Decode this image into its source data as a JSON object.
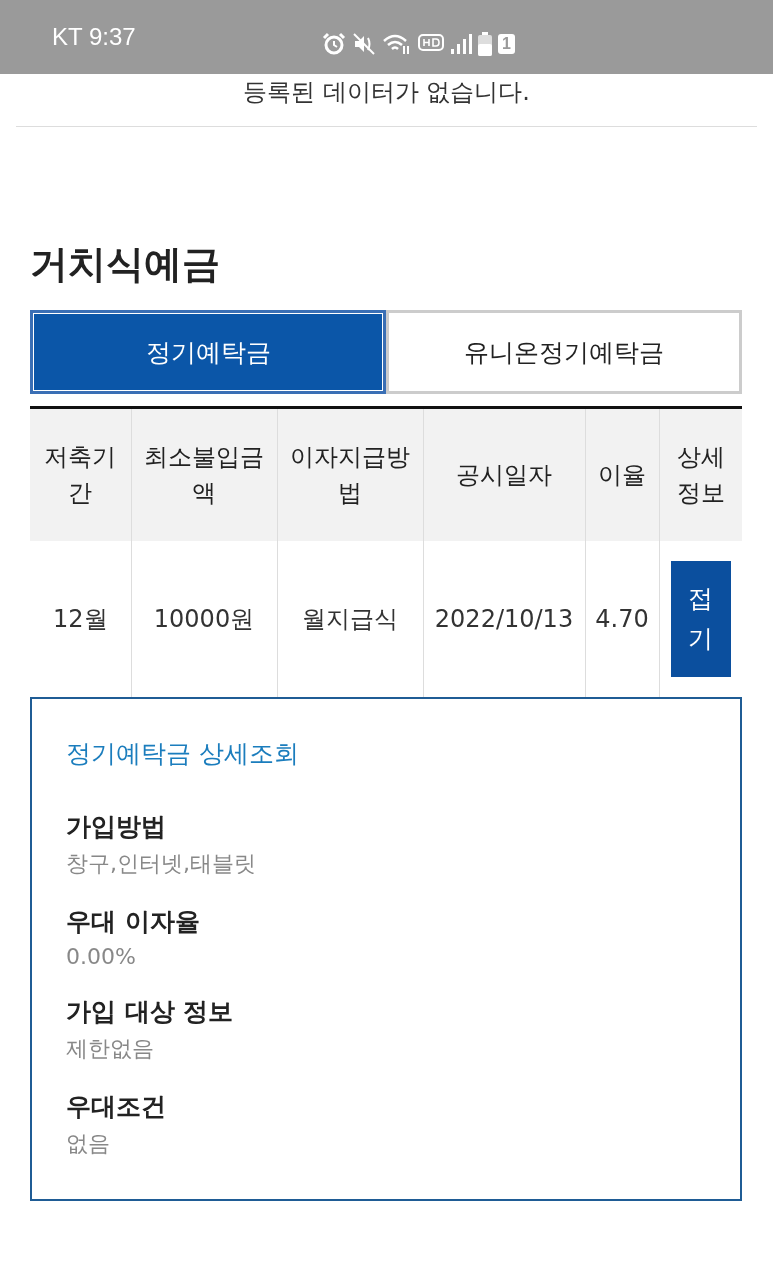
{
  "status_bar": {
    "carrier_time": "KT 9:37",
    "battery_badge": "1"
  },
  "notice": "등록된 데이터가 없습니다.",
  "section_title": "거치식예금",
  "tabs": [
    {
      "label": "정기예탁금",
      "selected": true
    },
    {
      "label": "유니온정기예탁금",
      "selected": false
    }
  ],
  "table": {
    "columns": [
      "저축기간",
      "최소불입금액",
      "이자지급방법",
      "공시일자",
      "이율",
      "상세정보"
    ],
    "rows": [
      {
        "cells": [
          "12월",
          "10000원",
          "월지급식",
          "2022/10/13",
          "4.70"
        ],
        "action": "접기",
        "expanded": true
      }
    ]
  },
  "detail": {
    "title": "정기예탁금 상세조회",
    "fields": [
      {
        "label": "가입방법",
        "value": "창구,인터넷,태블릿"
      },
      {
        "label": "우대 이자율",
        "value": "0.00%"
      },
      {
        "label": "가입 대상 정보",
        "value": "제한없음"
      },
      {
        "label": "우대조건",
        "value": "없음"
      }
    ]
  }
}
